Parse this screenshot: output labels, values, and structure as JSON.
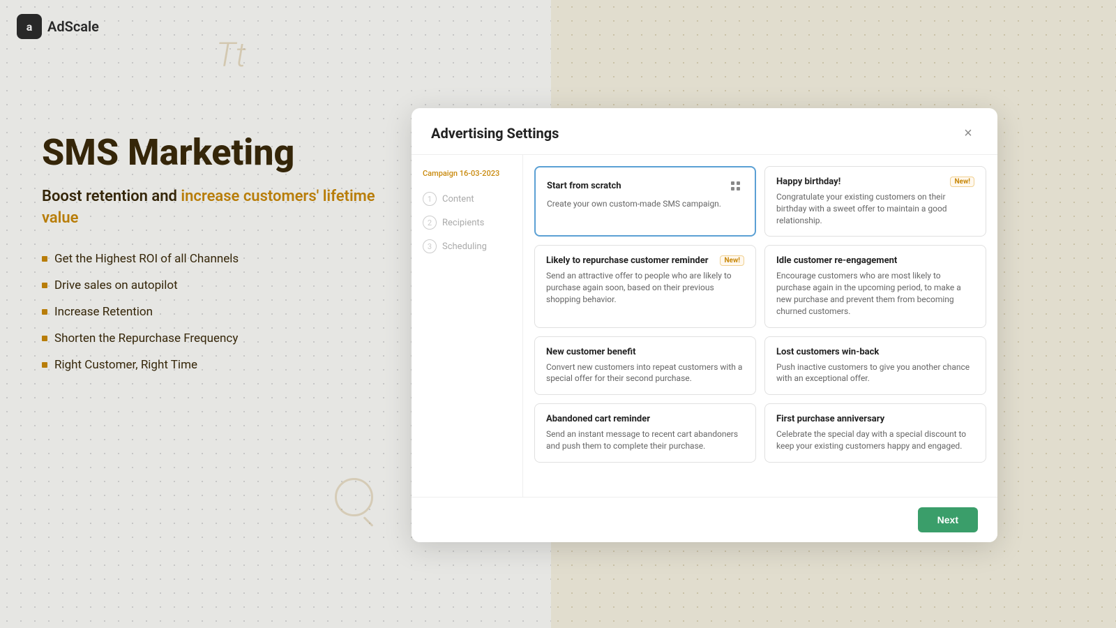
{
  "logo": {
    "icon_label": "a",
    "text": "AdScale"
  },
  "deco": {
    "tt": "Tt"
  },
  "hero": {
    "title": "SMS Marketing",
    "subtitle_plain": "Boost retention and ",
    "subtitle_highlight": "increase customers' lifetime value",
    "features": [
      "Get the Highest ROI of all Channels",
      "Drive sales on autopilot",
      "Increase Retention",
      "Shorten the Repurchase Frequency",
      "Right Customer, Right Time"
    ]
  },
  "modal": {
    "title": "Advertising Settings",
    "close_label": "×",
    "sidebar": {
      "campaign_date": "Campaign 16-03-2023",
      "steps": [
        {
          "number": "1",
          "label": "Content"
        },
        {
          "number": "2",
          "label": "Recipients"
        },
        {
          "number": "3",
          "label": "Scheduling"
        }
      ]
    },
    "templates": [
      {
        "id": "start-from-scratch",
        "title": "Start from scratch",
        "description": "Create your own custom-made SMS campaign.",
        "badge": null,
        "selected": true,
        "has_icon": true
      },
      {
        "id": "happy-birthday",
        "title": "Happy birthday!",
        "description": "Congratulate your existing customers on their birthday with a sweet offer to maintain a good relationship.",
        "badge": "New!",
        "selected": false,
        "has_icon": false
      },
      {
        "id": "likely-to-repurchase",
        "title": "Likely to repurchase customer reminder",
        "description": "Send an attractive offer to people who are likely to purchase again soon, based on their previous shopping behavior.",
        "badge": "New!",
        "selected": false,
        "has_icon": false
      },
      {
        "id": "idle-customer",
        "title": "Idle customer re-engagement",
        "description": "Encourage customers who are most likely to purchase again in the upcoming period, to make a new purchase and prevent them from becoming churned customers.",
        "badge": null,
        "selected": false,
        "has_icon": false
      },
      {
        "id": "new-customer-benefit",
        "title": "New customer benefit",
        "description": "Convert new customers into repeat customers with a special offer for their second purchase.",
        "badge": null,
        "selected": false,
        "has_icon": false
      },
      {
        "id": "lost-customers-winback",
        "title": "Lost customers win-back",
        "description": "Push inactive customers to give you another chance with an exceptional offer.",
        "badge": null,
        "selected": false,
        "has_icon": false
      },
      {
        "id": "abandoned-cart",
        "title": "Abandoned cart reminder",
        "description": "Send an instant message to recent cart abandoners and push them to complete their purchase.",
        "badge": null,
        "selected": false,
        "has_icon": false
      },
      {
        "id": "first-purchase-anniversary",
        "title": "First purchase anniversary",
        "description": "Celebrate the special day with a special discount to keep your existing customers happy and engaged.",
        "badge": null,
        "selected": false,
        "has_icon": false
      }
    ],
    "footer": {
      "next_label": "Next"
    }
  }
}
